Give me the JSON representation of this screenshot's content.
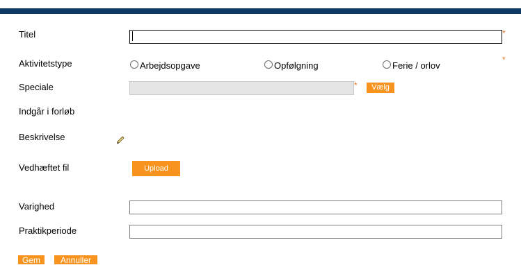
{
  "colors": {
    "header_bar": "#0e3a66",
    "accent": "#f7931e",
    "required_marker": "#e87722"
  },
  "form": {
    "title": {
      "label": "Titel",
      "value": "",
      "required_marker": "*"
    },
    "activity_type": {
      "label": "Aktivitetstype",
      "options": [
        "Arbejdsopgave",
        "Opfølgning",
        "Ferie / orlov"
      ],
      "selected": null,
      "required_marker": "*"
    },
    "speciale": {
      "label": "Speciale",
      "value": "",
      "required_marker": "*",
      "choose_button": "Vælg"
    },
    "included_in_course": {
      "label": "Indgår i forløb"
    },
    "description": {
      "label": "Beskrivelse",
      "edit_icon": "pencil-icon"
    },
    "attachment": {
      "label": "Vedhæftet fil",
      "upload_button": "Upload"
    },
    "duration": {
      "label": "Varighed",
      "value": ""
    },
    "internship_period": {
      "label": "Praktikperiode",
      "value": ""
    }
  },
  "actions": {
    "save_label": "Gem",
    "cancel_label": "Annuller"
  }
}
